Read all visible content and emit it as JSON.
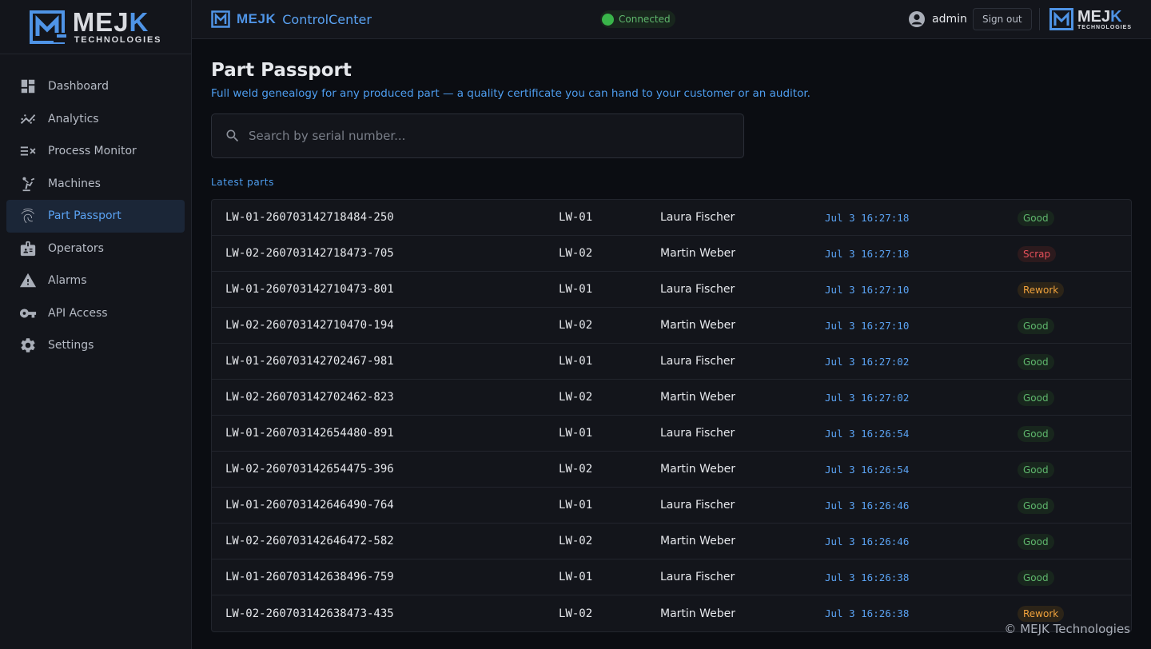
{
  "brand": {
    "name_main": "MEJ",
    "name_accent": "K",
    "sub": "TECHNOLOGIES"
  },
  "sidebar": {
    "items": [
      {
        "label": "Dashboard",
        "icon": "dashboard-icon",
        "active": false
      },
      {
        "label": "Analytics",
        "icon": "analytics-icon",
        "active": false
      },
      {
        "label": "Process Monitor",
        "icon": "process-monitor-icon",
        "active": false
      },
      {
        "label": "Machines",
        "icon": "robot-arm-icon",
        "active": false
      },
      {
        "label": "Part Passport",
        "icon": "fingerprint-icon",
        "active": true
      },
      {
        "label": "Operators",
        "icon": "badge-icon",
        "active": false
      },
      {
        "label": "Alarms",
        "icon": "warning-icon",
        "active": false
      },
      {
        "label": "API Access",
        "icon": "key-icon",
        "active": false
      },
      {
        "label": "Settings",
        "icon": "gear-icon",
        "active": false
      }
    ]
  },
  "header": {
    "app_brand": "MEJK",
    "app_name": "ControlCenter",
    "connection_status": "Connected",
    "username": "admin",
    "signout_label": "Sign out"
  },
  "main": {
    "title": "Part Passport",
    "subtitle": "Full weld genealogy for any produced part — a quality certificate you can hand to your customer or an auditor.",
    "search_placeholder": "Search by serial number...",
    "section_label": "Latest parts",
    "parts": [
      {
        "serial": "LW-01-260703142718484-250",
        "line": "LW-01",
        "operator": "Laura Fischer",
        "time": "Jul 3 16:27:18",
        "status": "Good"
      },
      {
        "serial": "LW-02-260703142718473-705",
        "line": "LW-02",
        "operator": "Martin Weber",
        "time": "Jul 3 16:27:18",
        "status": "Scrap"
      },
      {
        "serial": "LW-01-260703142710473-801",
        "line": "LW-01",
        "operator": "Laura Fischer",
        "time": "Jul 3 16:27:10",
        "status": "Rework"
      },
      {
        "serial": "LW-02-260703142710470-194",
        "line": "LW-02",
        "operator": "Martin Weber",
        "time": "Jul 3 16:27:10",
        "status": "Good"
      },
      {
        "serial": "LW-01-260703142702467-981",
        "line": "LW-01",
        "operator": "Laura Fischer",
        "time": "Jul 3 16:27:02",
        "status": "Good"
      },
      {
        "serial": "LW-02-260703142702462-823",
        "line": "LW-02",
        "operator": "Martin Weber",
        "time": "Jul 3 16:27:02",
        "status": "Good"
      },
      {
        "serial": "LW-01-260703142654480-891",
        "line": "LW-01",
        "operator": "Laura Fischer",
        "time": "Jul 3 16:26:54",
        "status": "Good"
      },
      {
        "serial": "LW-02-260703142654475-396",
        "line": "LW-02",
        "operator": "Martin Weber",
        "time": "Jul 3 16:26:54",
        "status": "Good"
      },
      {
        "serial": "LW-01-260703142646490-764",
        "line": "LW-01",
        "operator": "Laura Fischer",
        "time": "Jul 3 16:26:46",
        "status": "Good"
      },
      {
        "serial": "LW-02-260703142646472-582",
        "line": "LW-02",
        "operator": "Martin Weber",
        "time": "Jul 3 16:26:46",
        "status": "Good"
      },
      {
        "serial": "LW-01-260703142638496-759",
        "line": "LW-01",
        "operator": "Laura Fischer",
        "time": "Jul 3 16:26:38",
        "status": "Good"
      },
      {
        "serial": "LW-02-260703142638473-435",
        "line": "LW-02",
        "operator": "Martin Weber",
        "time": "Jul 3 16:26:38",
        "status": "Rework"
      }
    ]
  },
  "footer": {
    "copyright": "© MEJK Technologies"
  },
  "colors": {
    "accent": "#4f94e6",
    "good": "#5fb86d",
    "scrap": "#e5505a",
    "rework": "#f0a23c"
  }
}
